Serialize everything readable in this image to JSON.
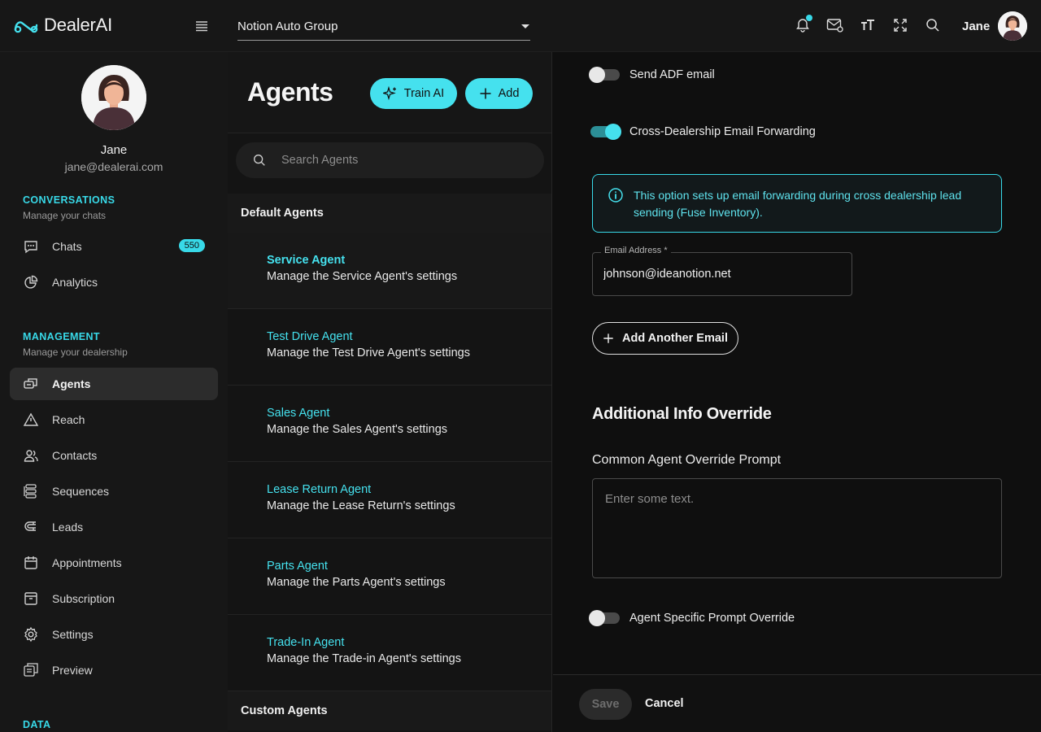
{
  "app": {
    "logo_text": "DealerAI"
  },
  "header": {
    "dealership": "Notion Auto Group",
    "user_name": "Jane"
  },
  "profile": {
    "name": "Jane",
    "email": "jane@dealerai.com"
  },
  "sidebar": {
    "conversations_title": "CONVERSATIONS",
    "conversations_sub": "Manage your chats",
    "management_title": "MANAGEMENT",
    "management_sub": "Manage your dealership",
    "data_title": "DATA",
    "chats": {
      "label": "Chats",
      "badge": "550"
    },
    "analytics": {
      "label": "Analytics"
    },
    "items": [
      {
        "label": "Agents"
      },
      {
        "label": "Reach"
      },
      {
        "label": "Contacts"
      },
      {
        "label": "Sequences"
      },
      {
        "label": "Leads"
      },
      {
        "label": "Appointments"
      },
      {
        "label": "Subscription"
      },
      {
        "label": "Settings"
      },
      {
        "label": "Preview"
      }
    ]
  },
  "agents_panel": {
    "title": "Agents",
    "train_label": "Train AI",
    "add_label": "Add",
    "search_placeholder": "Search Agents",
    "default_header": "Default Agents",
    "custom_header": "Custom Agents",
    "agents": [
      {
        "name": "Service Agent",
        "desc": "Manage the Service Agent's settings"
      },
      {
        "name": "Test Drive Agent",
        "desc": "Manage the Test Drive Agent's settings"
      },
      {
        "name": "Sales Agent",
        "desc": "Manage the Sales Agent's settings"
      },
      {
        "name": "Lease Return Agent",
        "desc": "Manage the Lease Return's settings"
      },
      {
        "name": "Parts Agent",
        "desc": "Manage the Parts Agent's settings"
      },
      {
        "name": "Trade-In Agent",
        "desc": "Manage the Trade-in Agent's settings"
      }
    ]
  },
  "settings": {
    "send_adf_label": "Send ADF email",
    "send_adf_on": false,
    "cross_label": "Cross-Dealership Email Forwarding",
    "cross_on": true,
    "info_text": "This option sets up email forwarding during cross dealership lead sending (Fuse Inventory).",
    "email_label": "Email Address *",
    "email_value": "johnson@ideanotion.net",
    "add_email_label": "Add Another Email",
    "section_heading": "Additional Info Override",
    "override_label": "Common Agent Override Prompt",
    "override_placeholder": "Enter some text.",
    "agent_specific_label": "Agent Specific Prompt Override",
    "agent_specific_on": false,
    "save_label": "Save",
    "cancel_label": "Cancel"
  },
  "colors": {
    "accent": "#45e1ee",
    "background": "#0f0f0f",
    "panel": "#171717"
  }
}
